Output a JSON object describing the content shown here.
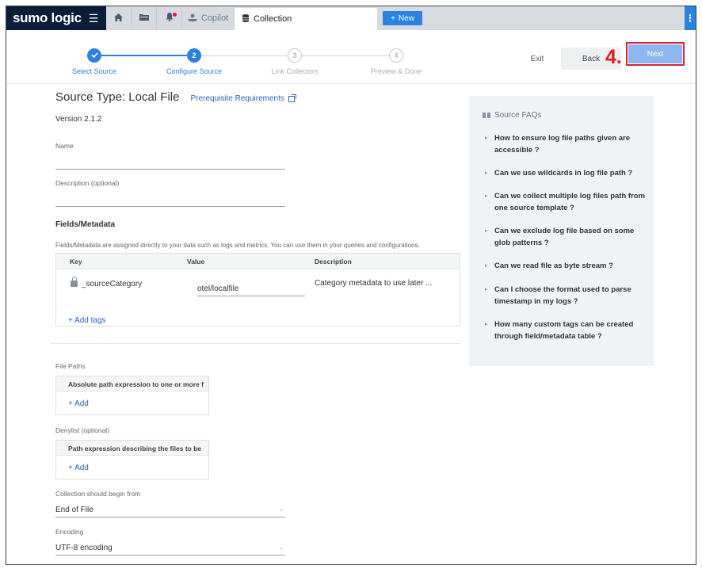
{
  "topbar": {
    "brand": "sumo logic",
    "tabs": {
      "copilot": "Copilot",
      "collection": "Collection"
    },
    "new_label": "New"
  },
  "wizard": {
    "steps": [
      {
        "num": "",
        "label": "Select Source",
        "state": "done"
      },
      {
        "num": "2",
        "label": "Configure Source",
        "state": "active"
      },
      {
        "num": "3",
        "label": "Link Collectors",
        "state": "todo"
      },
      {
        "num": "4",
        "label": "Preview & Done",
        "state": "todo"
      }
    ],
    "exit_label": "Exit",
    "back_label": "Back",
    "next_label": "Next",
    "annotation": "4."
  },
  "form": {
    "source_type": "Source Type: Local File",
    "prereq_link": "Prerequisite Requirements",
    "version": "Version 2.1.2",
    "name_label": "Name",
    "name_value": "",
    "description_label": "Description (optional)",
    "description_value": "",
    "fields_title": "Fields/Metadata",
    "fields_note": "Fields/Metadata are assigned directly to your data such as logs and metrics. You can use them in your queries and configurations.",
    "table_headers": {
      "key": "Key",
      "value": "Value",
      "description": "Description"
    },
    "table_row": {
      "key": "_sourceCategory",
      "value": "otel/localfile",
      "description": "Category metadata to use later ..."
    },
    "add_tags": "+ Add tags",
    "file_paths_label": "File Paths",
    "file_paths_head": "Absolute path expression to one or more f",
    "add_label": "+ Add",
    "denylist_label": "Denylist (optional)",
    "denylist_head": "Path expression describing the files to be",
    "collection_begin_label": "Collection should begin from",
    "collection_begin_value": "End of File",
    "encoding_label": "Encoding",
    "encoding_value": "UTF-8 encoding"
  },
  "faq": {
    "title": "Source FAQs",
    "items": [
      "How to ensure log file paths given are accessible ?",
      "Can we use wildcards in log file path ?",
      "Can we collect multiple log files path from one source template ?",
      "Can we exclude log file based on some glob patterns ?",
      "Can we read file as byte stream ?",
      "Can I choose the format used to parse timestamp in my logs ?",
      "How many custom tags can be created through field/metadata table ?"
    ]
  },
  "colors": {
    "brand_bg": "#0a1d39",
    "accent": "#2c82e1",
    "next_disabled": "#8db7ee",
    "annotation_red": "#e21c1c"
  }
}
